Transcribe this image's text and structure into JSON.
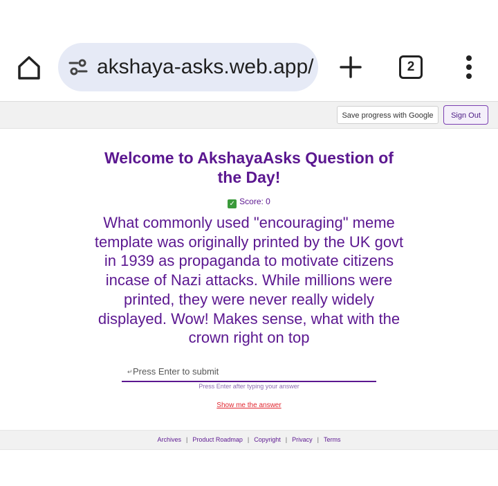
{
  "browser": {
    "url": "akshaya-asks.web.app/",
    "tab_count": "2"
  },
  "header": {
    "save_progress_label": "Save progress with Google",
    "sign_out_label": "Sign Out"
  },
  "main": {
    "title": "Welcome to AkshayaAsks Question of the Day!",
    "score_label": "Score: 0",
    "question": "What commonly used \"encouraging\" meme template was originally printed by the UK govt in 1939 as propaganda to motivate citizens incase of Nazi attacks. While millions were printed, they were never really widely displayed. Wow! Makes sense, what with the crown right on top",
    "answer_placeholder": "Press Enter to submit",
    "answer_hint": "Press Enter after typing your answer",
    "show_answer_label": "Show me the answer"
  },
  "footer": {
    "links": [
      "Archives",
      "Product Roadmap",
      "Copyright",
      "Privacy",
      "Terms"
    ]
  },
  "colors": {
    "accent": "#5b1790",
    "link_red": "#e0262f",
    "url_pill_bg": "#e6eaf6"
  },
  "icons": {
    "home": "home-icon",
    "site_settings": "tune-icon",
    "new_tab": "plus-icon",
    "tabs": "tab-switcher-icon",
    "menu": "more-vert-icon",
    "score": "check-mark-icon",
    "input_arrow": "return-arrow-icon"
  }
}
